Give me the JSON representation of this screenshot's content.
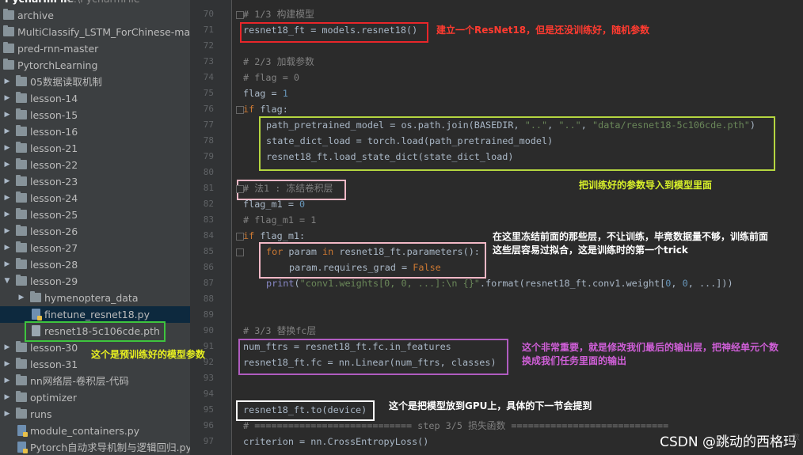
{
  "sidebar": {
    "top_cut_label": "PycharmFile",
    "top_cut_path": "C:\\PycharmFile",
    "items": [
      {
        "label": "archive",
        "type": "folder"
      },
      {
        "label": "MultiClassify_LSTM_ForChinese-master",
        "type": "folder"
      },
      {
        "label": "pred-rnn-master",
        "type": "folder"
      },
      {
        "label": "PytorchLearning",
        "type": "folder"
      },
      {
        "label": "05数据读取机制",
        "type": "folder"
      },
      {
        "label": "lesson-14",
        "type": "folder"
      },
      {
        "label": "lesson-15",
        "type": "folder"
      },
      {
        "label": "lesson-16",
        "type": "folder"
      },
      {
        "label": "lesson-21",
        "type": "folder"
      },
      {
        "label": "lesson-22",
        "type": "folder"
      },
      {
        "label": "lesson-23",
        "type": "folder"
      },
      {
        "label": "lesson-24",
        "type": "folder"
      },
      {
        "label": "lesson-25",
        "type": "folder"
      },
      {
        "label": "lesson-26",
        "type": "folder"
      },
      {
        "label": "lesson-27",
        "type": "folder"
      },
      {
        "label": "lesson-28",
        "type": "folder"
      },
      {
        "label": "lesson-29",
        "type": "folder"
      },
      {
        "label": "hymenoptera_data",
        "type": "folder"
      },
      {
        "label": "finetune_resnet18.py",
        "type": "py"
      },
      {
        "label": "resnet18-5c106cde.pth",
        "type": "pth"
      },
      {
        "label": "lesson-30",
        "type": "folder"
      },
      {
        "label": "lesson-31",
        "type": "folder"
      },
      {
        "label": "nn网络层-卷积层-代码",
        "type": "folder"
      },
      {
        "label": "optimizer",
        "type": "folder"
      },
      {
        "label": "runs",
        "type": "folder"
      },
      {
        "label": "module_containers.py",
        "type": "py"
      },
      {
        "label": "Pytorch自动求导机制与逻辑回归.py",
        "type": "py"
      }
    ]
  },
  "gutter": {
    "line_numbers": [
      "70",
      "71",
      "72",
      "73",
      "74",
      "75",
      "76",
      "77",
      "78",
      "79",
      "80",
      "81",
      "82",
      "83",
      "84",
      "85",
      "86",
      "87",
      "88",
      "89",
      "90",
      "91",
      "92",
      "93",
      "94",
      "95",
      "96",
      "97"
    ]
  },
  "code": {
    "l70_comment": "# 1/3 构建模型",
    "l71": [
      "resnet18_ft = models.resnet18()"
    ],
    "l73_comment": "# 2/3 加载参数",
    "l74_comment": "# flag = 0",
    "l75": [
      "flag = ",
      "1"
    ],
    "l76": [
      "if",
      " flag:"
    ],
    "l77": [
      "path_pretrained_model = os.path.join(BASEDIR, ",
      "\"..\"",
      ", ",
      "\"..\"",
      ", ",
      "\"data/resnet18-5c106cde.pth\"",
      ")"
    ],
    "l78": [
      "state_dict_load = torch.load(path_pretrained_model)"
    ],
    "l79": [
      "resnet18_ft.load_state_dict(state_dict_load)"
    ],
    "l81_comment": "# 法1 : 冻结卷积层",
    "l82": [
      "flag_m1 = ",
      "0"
    ],
    "l83_comment": "# flag_m1 = 1",
    "l84": [
      "if",
      " flag_m1:"
    ],
    "l85": [
      "for",
      " param ",
      "in",
      " resnet18_ft.parameters():"
    ],
    "l86": [
      "param.requires_grad = ",
      "False"
    ],
    "l87": [
      "print",
      "(",
      "\"conv1.weights[0, 0, ...]:\\n {}\"",
      ".format(resnet18_ft.conv1.weight[",
      "0",
      ", ",
      "0",
      ", ...]))"
    ],
    "l90_comment": "# 3/3 替换fc层",
    "l91": [
      "num_ftrs = resnet18_ft.fc.in_features"
    ],
    "l92": [
      "resnet18_ft.fc = nn.Linear(num_ftrs, classes)"
    ],
    "l95": [
      "resnet18_ft.to(device)"
    ],
    "l96_comment": "# ============================ step 3/5 损失函数 ============================",
    "l97": [
      "criterion = nn.CrossEntropyLoss()"
    ]
  },
  "annotations": {
    "red": "建立一个ResNet18，但是还没训练好，随机参数",
    "yellow_green": "把训练好的参数导入到模型里面",
    "pink_line1": "在这里冻结前面的那些层，不让训练，毕竟数据量不够，训练前面",
    "pink_line2": "这些层容易过拟合，这是训练时的第一个trick",
    "purple_line1": "这个非常重要，就是修改我们最后的输出层，把神经单元个数",
    "purple_line2": "换成我们任务里面的输出",
    "white": "这个是把模型放到GPU上，具体的下一节会提到",
    "green": "这个是预训练好的模型参数"
  },
  "colors": {
    "red_box": "#e8262a",
    "yellow_green_box": "#b5d640",
    "pink_box": "#f2b8c6",
    "purple_box": "#b05cc0",
    "white_box": "#ffffff",
    "green_box": "#3ec43e",
    "red_text": "#ff3b30",
    "yellow_green_text": "#d8f02a",
    "pink_text": "#ffffff",
    "purple_text": "#d05fd8",
    "green_text": "#e8f020"
  },
  "watermark": {
    "text": "CSDN @跳动的西格玛",
    "faint": "数"
  }
}
